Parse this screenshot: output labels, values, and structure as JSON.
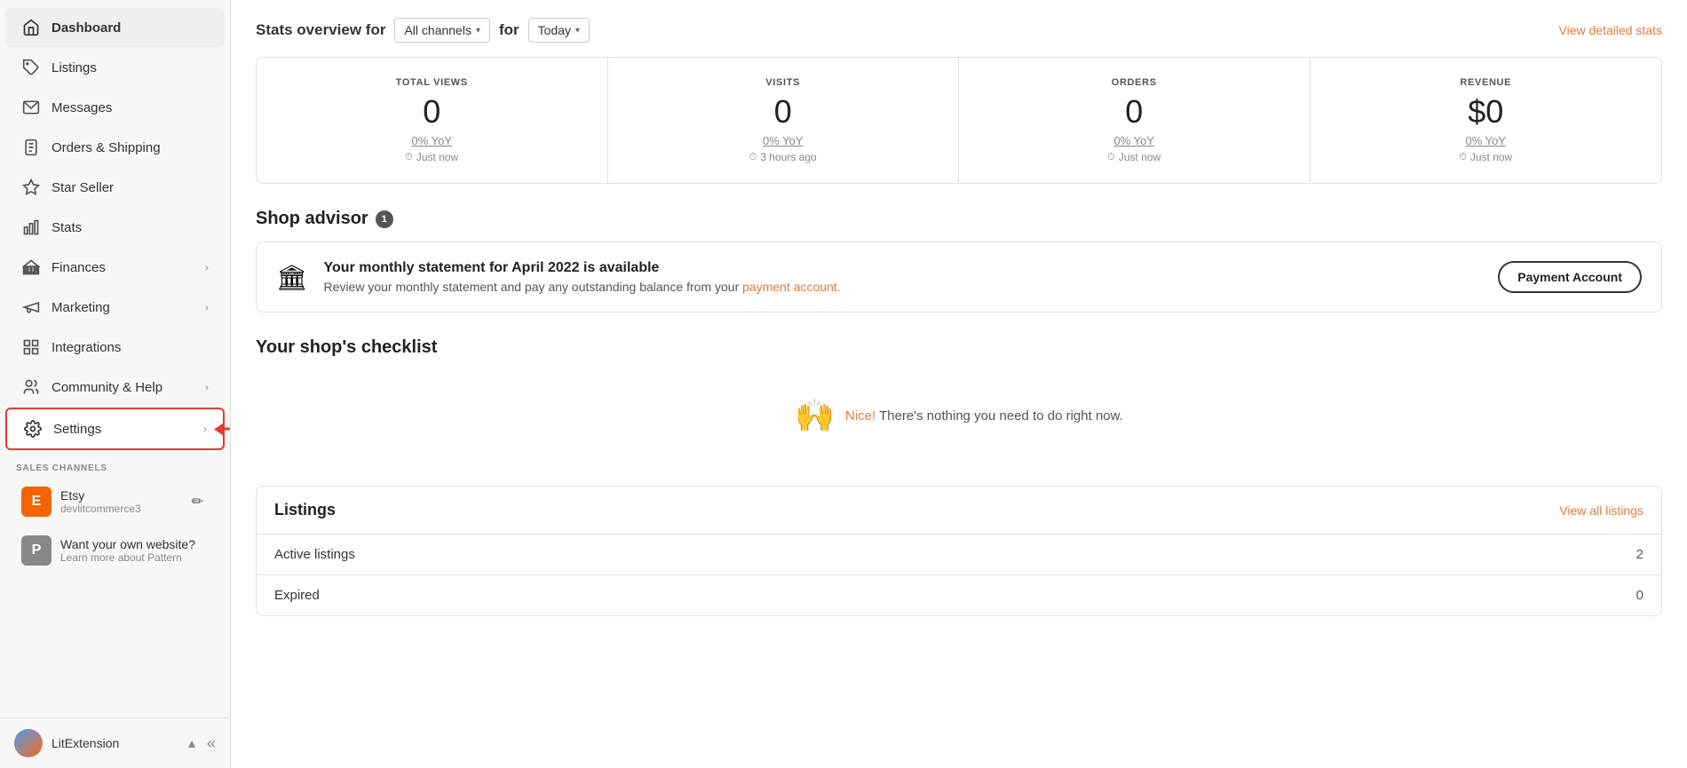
{
  "sidebar": {
    "nav_items": [
      {
        "id": "dashboard",
        "label": "Dashboard",
        "icon": "home",
        "active": true,
        "has_chevron": false
      },
      {
        "id": "listings",
        "label": "Listings",
        "icon": "tag",
        "active": false,
        "has_chevron": false
      },
      {
        "id": "messages",
        "label": "Messages",
        "icon": "mail",
        "active": false,
        "has_chevron": false
      },
      {
        "id": "orders-shipping",
        "label": "Orders & Shipping",
        "icon": "clipboard",
        "active": false,
        "has_chevron": false
      },
      {
        "id": "star-seller",
        "label": "Star Seller",
        "icon": "star",
        "active": false,
        "has_chevron": false
      },
      {
        "id": "stats",
        "label": "Stats",
        "icon": "bar-chart",
        "active": false,
        "has_chevron": false
      },
      {
        "id": "finances",
        "label": "Finances",
        "icon": "bank",
        "active": false,
        "has_chevron": true
      },
      {
        "id": "marketing",
        "label": "Marketing",
        "icon": "megaphone",
        "active": false,
        "has_chevron": true
      },
      {
        "id": "integrations",
        "label": "Integrations",
        "icon": "grid",
        "active": false,
        "has_chevron": false
      },
      {
        "id": "community-help",
        "label": "Community & Help",
        "icon": "people",
        "active": false,
        "has_chevron": true
      },
      {
        "id": "settings",
        "label": "Settings",
        "icon": "gear",
        "active": false,
        "has_chevron": true,
        "highlighted": true
      }
    ],
    "sales_channels_label": "SALES CHANNELS",
    "etsy_channel": {
      "badge": "E",
      "name": "Etsy",
      "sub": "devlitcommerce3"
    },
    "pattern_channel": {
      "badge": "P",
      "name": "Want your own website?",
      "sub": "Learn more about Pattern"
    },
    "footer": {
      "label": "LitExtension"
    }
  },
  "main": {
    "stats_overview": {
      "title": "Stats overview for",
      "channel_dropdown": "All channels",
      "for_label": "for",
      "period_dropdown": "Today",
      "view_link": "View detailed stats"
    },
    "stats_cards": [
      {
        "label": "TOTAL VIEWS",
        "value": "0",
        "yoy": "0% YoY",
        "time": "Just now"
      },
      {
        "label": "VISITS",
        "value": "0",
        "yoy": "0% YoY",
        "time": "3 hours ago"
      },
      {
        "label": "ORDERS",
        "value": "0",
        "yoy": "0% YoY",
        "time": "Just now"
      },
      {
        "label": "REVENUE",
        "value": "$0",
        "yoy": "0% YoY",
        "time": "Just now"
      }
    ],
    "shop_advisor": {
      "title": "Shop advisor",
      "badge_count": "1",
      "advisor_title": "Your monthly statement for April 2022 is available",
      "advisor_desc": "Review your monthly statement and pay any outstanding balance from your payment account.",
      "payment_btn": "Payment Account"
    },
    "checklist": {
      "title": "Your shop's checklist",
      "empty_msg": "Nice! There's nothing you need to do right now."
    },
    "listings": {
      "title": "Listings",
      "view_all": "View all listings",
      "rows": [
        {
          "label": "Active listings",
          "count": "2"
        },
        {
          "label": "Expired",
          "count": "0"
        }
      ]
    }
  }
}
